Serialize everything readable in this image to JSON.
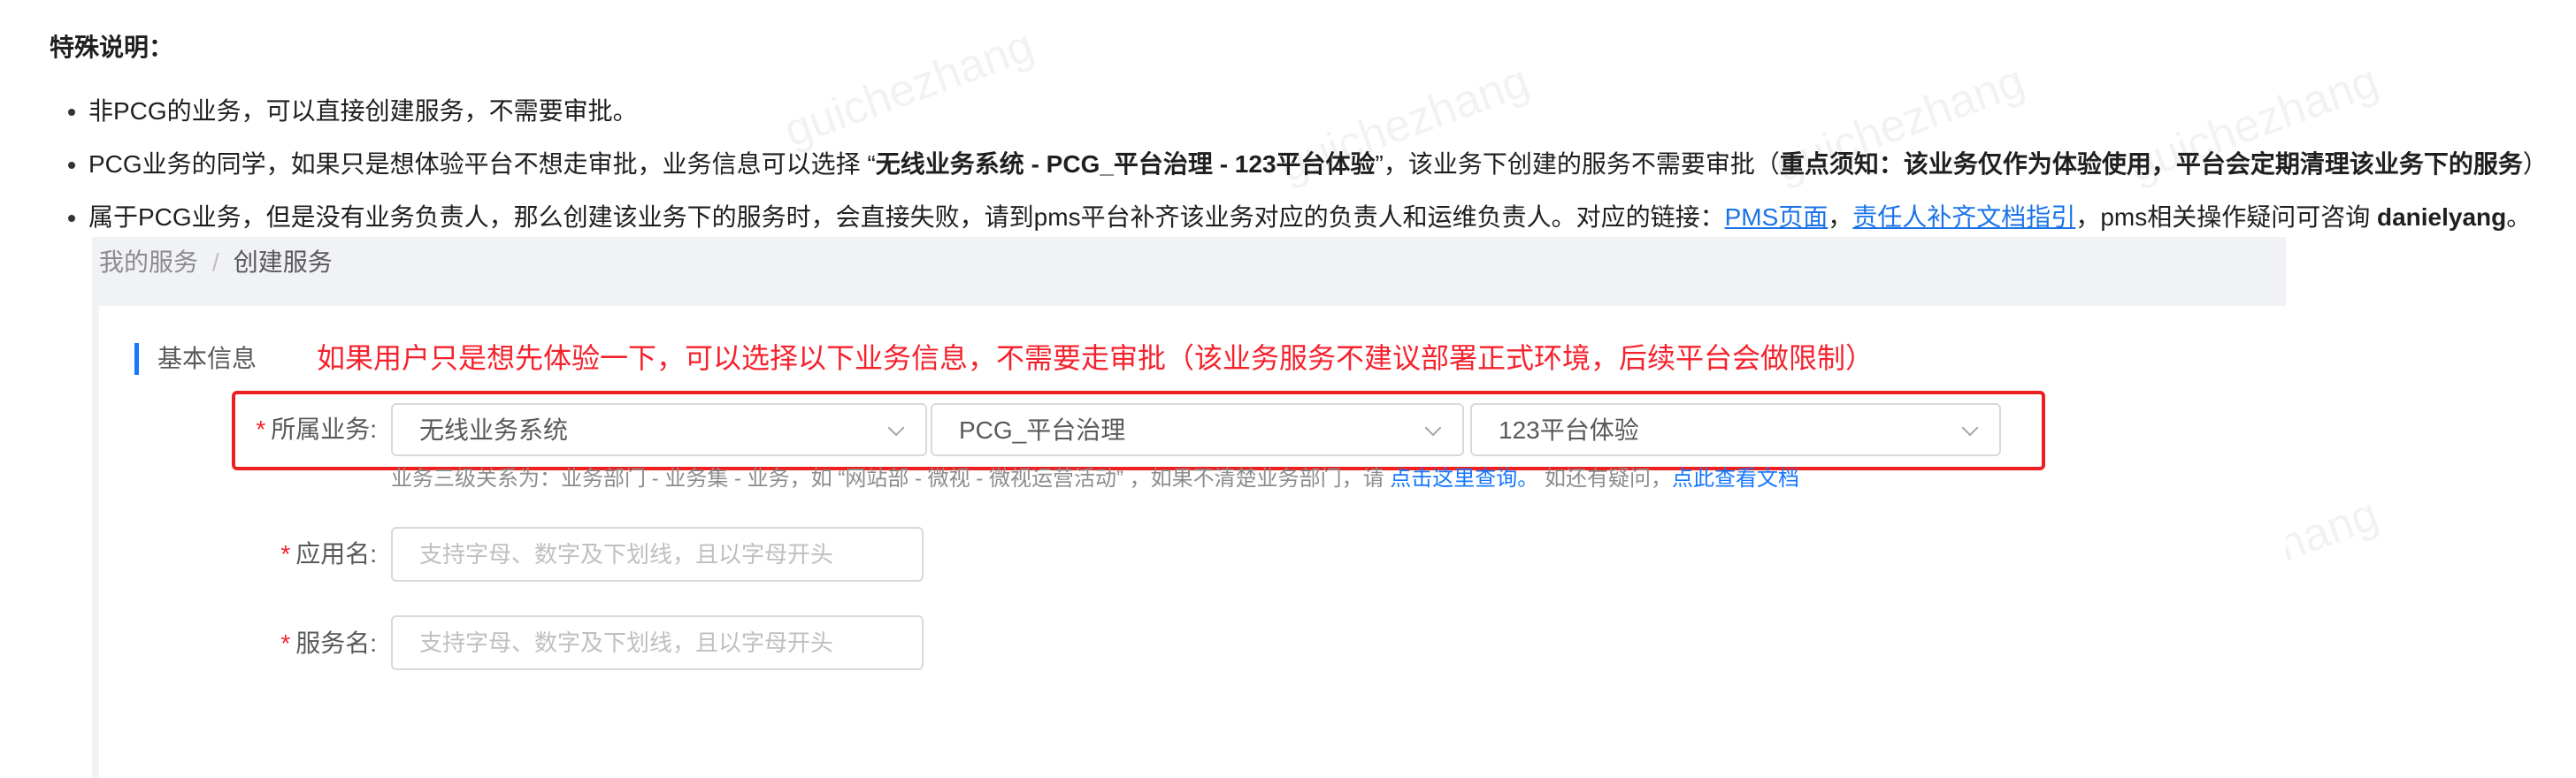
{
  "title": "特殊说明：",
  "notes": {
    "item1": "非PCG的业务，可以直接创建服务，不需要审批。",
    "item2": {
      "prefix": "PCG业务的同学，如果只是想体验平台不想走审批，业务信息可以选择 “",
      "bold": "无线业务系统 - PCG_平台治理 - 123平台体验",
      "middle": "”，该业务下创建的服务不需要审批（",
      "bold2": "重点须知：该业务仅作为体验使用，平台会定期清理该业务下的服务",
      "suffix": "）"
    },
    "item3": {
      "prefix": "属于PCG业务，但是没有业务负责人，那么创建该业务下的服务时，会直接失败，请到pms平台补齐该业务对应的负责人和运维负责人。对应的链接：",
      "link1": "PMS页面",
      "comma": "，",
      "link2": "责任人补齐文档指引",
      "suffix": "，pms相关操作疑问可咨询 ",
      "bold": "danielyang",
      "end": "。"
    }
  },
  "breadcrumb": {
    "parent": "我的服务",
    "sep": "/",
    "current": "创建服务"
  },
  "section": {
    "title": "基本信息",
    "notice": "如果用户只是想先体验一下，可以选择以下业务信息，不需要走审批（该业务服务不建议部署正式环境，后续平台会做限制）"
  },
  "form": {
    "business": {
      "required": "*",
      "label": "所属业务:",
      "level1": "无线业务系统",
      "level2": "PCG_平台治理",
      "level3": "123平台体验"
    },
    "help": {
      "text": "业务三级关系为：业务部门 - 业务集 - 业务，如 “网站部 - 微视 - 微视运营活动” ，如果不清楚业务部门，请 ",
      "link1": "点击这里查询。",
      "mid": " 如还有疑问，",
      "link2": "点此查看文档"
    },
    "app_name": {
      "required": "*",
      "label": "应用名:",
      "placeholder": "支持字母、数字及下划线，且以字母开头"
    },
    "service_name": {
      "required": "*",
      "label": "服务名:",
      "placeholder": "支持字母、数字及下划线，且以字母开头"
    }
  },
  "watermark": "guichezhang",
  "colors": {
    "accent": "#1677ff",
    "required": "#f5222d",
    "notice": "#f5222d",
    "highlight_box": "#ee1f1f",
    "link": "#1a73e8"
  }
}
